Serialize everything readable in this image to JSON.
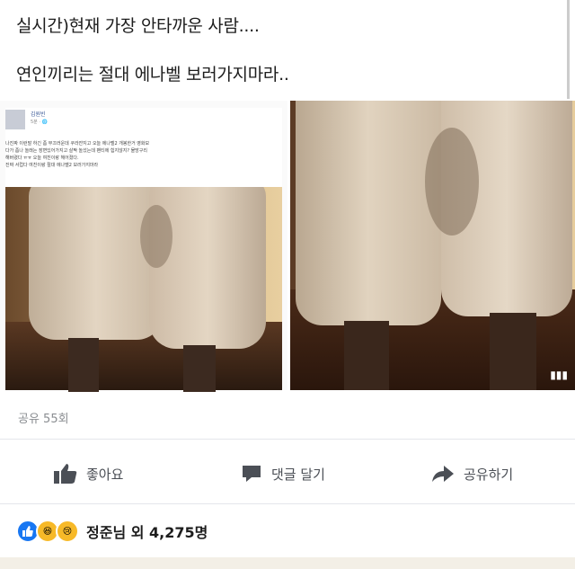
{
  "headline": {
    "line1": "실시간)현재 가장 안타까운 사람....",
    "line2": "연인끼리는 절대 에나벨 보러가지마라.."
  },
  "embedded_post": {
    "poster_name": "김원빈",
    "meta": "5분 · 🌐",
    "lines": [
      "나진짜 이런말 하긴 좀 부끄러운데 쿠라쟌지고 오늘 에나벨2 개봉한거 영화보",
      "다가 좀나 놀래는 장면있어가지고 살짝 놀섰는데 팬티에 힘지않지? 물방구리",
      "해버렸다 ㅠㅠ 오늘 여친이랑 헤어졌다.",
      "진짜 서럽다 여친이랑 절대 에나벨2 보러가지마라"
    ]
  },
  "share_count": "공유 55회",
  "actions": {
    "like": "좋아요",
    "comment": "댓글 달기",
    "share": "공유하기"
  },
  "reactions": {
    "text": "정준님 외 4,275명"
  },
  "colors": {
    "accent": "#1877f2",
    "pants": "#d9c8b4",
    "background_dark": "#4a2a18",
    "floor": "#c4a27a"
  }
}
